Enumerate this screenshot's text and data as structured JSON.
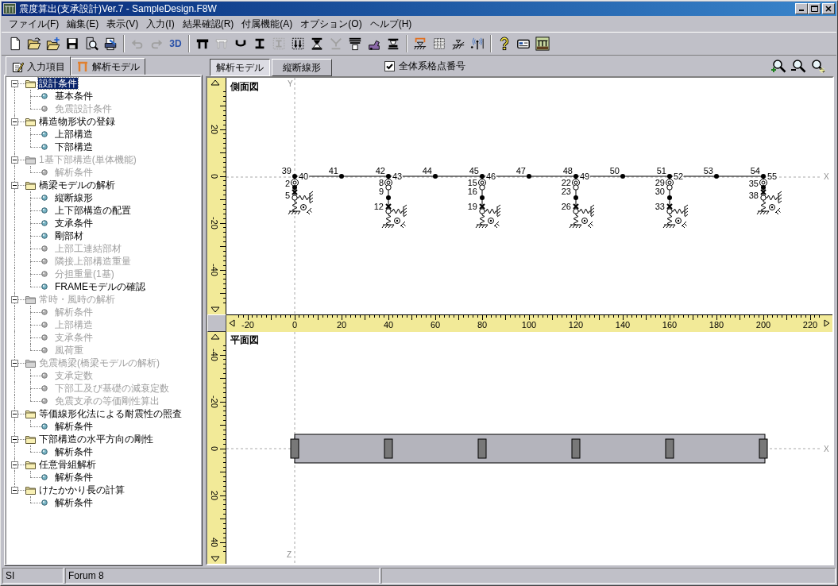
{
  "window": {
    "title": "震度算出(支承設計)Ver.7 - SampleDesign.F8W"
  },
  "menu": [
    "ファイル(F)",
    "編集(E)",
    "表示(V)",
    "入力(I)",
    "結果確認(R)",
    "付属機能(A)",
    "オプション(O)",
    "ヘルプ(H)"
  ],
  "toolbar": [
    [
      {
        "kind": "icon",
        "disabled": false
      },
      {
        "kind": "icon",
        "disabled": false
      },
      {
        "kind": "icon",
        "disabled": false
      },
      {
        "kind": "icon",
        "disabled": false
      },
      {
        "kind": "icon",
        "disabled": false
      },
      {
        "kind": "icon",
        "disabled": false
      }
    ],
    [
      {
        "kind": "icon",
        "disabled": true
      },
      {
        "kind": "icon",
        "disabled": true
      },
      {
        "kind": "text",
        "label": "3D",
        "disabled": false
      }
    ],
    [
      {
        "kind": "icon",
        "disabled": false
      },
      {
        "kind": "icon",
        "disabled": true
      },
      {
        "kind": "icon",
        "disabled": false
      },
      {
        "kind": "icon",
        "disabled": false
      },
      {
        "kind": "icon",
        "disabled": true
      },
      {
        "kind": "icon",
        "disabled": false
      },
      {
        "kind": "icon",
        "disabled": false
      },
      {
        "kind": "icon",
        "disabled": true
      },
      {
        "kind": "icon",
        "disabled": false
      },
      {
        "kind": "icon",
        "disabled": false
      },
      {
        "kind": "icon",
        "disabled": false
      }
    ],
    [
      {
        "kind": "icon",
        "disabled": false
      },
      {
        "kind": "icon",
        "disabled": false
      },
      {
        "kind": "icon",
        "disabled": false
      },
      {
        "kind": "icon",
        "disabled": false
      }
    ],
    [
      {
        "kind": "icon",
        "disabled": false
      },
      {
        "kind": "icon",
        "disabled": false
      },
      {
        "kind": "icon",
        "disabled": false
      }
    ]
  ],
  "panel_tabs": [
    {
      "label": "入力項目",
      "selected": true
    },
    {
      "label": "解析モデル",
      "selected": false
    }
  ],
  "tree": [
    {
      "label": "設計条件",
      "selected": true,
      "disabled": false,
      "expanded": true,
      "children": [
        {
          "label": "基本条件",
          "selected": false,
          "disabled": false
        },
        {
          "label": "免震設計条件",
          "selected": false,
          "disabled": true
        }
      ]
    },
    {
      "label": "構造物形状の登録",
      "selected": false,
      "disabled": false,
      "expanded": true,
      "children": [
        {
          "label": "上部構造",
          "selected": false,
          "disabled": false
        },
        {
          "label": "下部構造",
          "selected": false,
          "disabled": false
        }
      ]
    },
    {
      "label": "1基下部構造(単体機能)",
      "selected": false,
      "disabled": true,
      "expanded": true,
      "children": [
        {
          "label": "解析条件",
          "selected": false,
          "disabled": true
        }
      ]
    },
    {
      "label": "橋梁モデルの解析",
      "selected": false,
      "disabled": false,
      "expanded": true,
      "children": [
        {
          "label": "縦断線形",
          "selected": false,
          "disabled": false
        },
        {
          "label": "上下部構造の配置",
          "selected": false,
          "disabled": false
        },
        {
          "label": "支承条件",
          "selected": false,
          "disabled": false
        },
        {
          "label": "剛部材",
          "selected": false,
          "disabled": false
        },
        {
          "label": "上部工連結部材",
          "selected": false,
          "disabled": true
        },
        {
          "label": "隣接上部構造重量",
          "selected": false,
          "disabled": true
        },
        {
          "label": "分担重量(1基)",
          "selected": false,
          "disabled": true
        },
        {
          "label": "FRAMEモデルの確認",
          "selected": false,
          "disabled": false
        }
      ]
    },
    {
      "label": "常時・風時の解析",
      "selected": false,
      "disabled": true,
      "expanded": true,
      "children": [
        {
          "label": "解析条件",
          "selected": false,
          "disabled": true
        },
        {
          "label": "上部構造",
          "selected": false,
          "disabled": true
        },
        {
          "label": "支承条件",
          "selected": false,
          "disabled": true
        },
        {
          "label": "風荷重",
          "selected": false,
          "disabled": true
        }
      ]
    },
    {
      "label": "免震橋梁(橋梁モデルの解析)",
      "selected": false,
      "disabled": true,
      "expanded": true,
      "children": [
        {
          "label": "支承定数",
          "selected": false,
          "disabled": true
        },
        {
          "label": "下部工及び基礎の減衰定数",
          "selected": false,
          "disabled": true
        },
        {
          "label": "免震支承の等価剛性算出",
          "selected": false,
          "disabled": true
        }
      ]
    },
    {
      "label": "等価線形化法による耐震性の照査",
      "selected": false,
      "disabled": false,
      "expanded": true,
      "children": [
        {
          "label": "解析条件",
          "selected": false,
          "disabled": false
        }
      ]
    },
    {
      "label": "下部構造の水平方向の剛性",
      "selected": false,
      "disabled": false,
      "expanded": true,
      "children": [
        {
          "label": "解析条件",
          "selected": false,
          "disabled": false
        }
      ]
    },
    {
      "label": "任意骨組解析",
      "selected": false,
      "disabled": false,
      "expanded": true,
      "children": [
        {
          "label": "解析条件",
          "selected": false,
          "disabled": false
        }
      ]
    },
    {
      "label": "けたかかり長の計算",
      "selected": false,
      "disabled": false,
      "expanded": true,
      "children": [
        {
          "label": "解析条件",
          "selected": false,
          "disabled": false
        }
      ]
    }
  ],
  "view_tabs": [
    {
      "label": "解析モデル",
      "selected": true
    },
    {
      "label": "縦断線形",
      "selected": false
    }
  ],
  "node_numbers_checkbox": {
    "label": "全体系格点番号",
    "checked": true
  },
  "side_view": {
    "title": "側面図",
    "y_axis_label": "Y",
    "x_axis_label": "X",
    "ruler_labels": [
      "20",
      "0",
      "-20",
      "-40"
    ],
    "supports": [
      {
        "kind": "abutment",
        "left_label": "39",
        "right_label": "40",
        "node_labels": [
          "2",
          "5"
        ]
      },
      {
        "kind": "pier",
        "left_label": "42",
        "right_label": "43",
        "node_labels": [
          "8",
          "9",
          "12"
        ]
      },
      {
        "kind": "pier",
        "left_label": "45",
        "right_label": "46",
        "node_labels": [
          "15",
          "16",
          "19"
        ]
      },
      {
        "kind": "pier",
        "left_label": "48",
        "right_label": "49",
        "node_labels": [
          "22",
          "23",
          "26"
        ]
      },
      {
        "kind": "pier",
        "left_label": "51",
        "right_label": "52",
        "node_labels": [
          "29",
          "30",
          "33"
        ]
      },
      {
        "kind": "abutment",
        "left_label": "54",
        "right_label": "55",
        "node_labels": [
          "35",
          "38"
        ]
      }
    ],
    "girder_node_labels": [
      "41",
      "44",
      "47",
      "50",
      "53"
    ]
  },
  "horizontal_ruler": {
    "labels": [
      "-20",
      "0",
      "20",
      "40",
      "60",
      "80",
      "100",
      "120",
      "140",
      "160",
      "180",
      "200",
      "220"
    ]
  },
  "plan_view": {
    "title": "平面図",
    "x_axis_label": "X",
    "z_axis_label": "Z",
    "ruler_labels": [
      "-40",
      "-20",
      "0",
      "20",
      "40"
    ]
  },
  "status_bar": [
    "SI",
    "Forum 8"
  ]
}
